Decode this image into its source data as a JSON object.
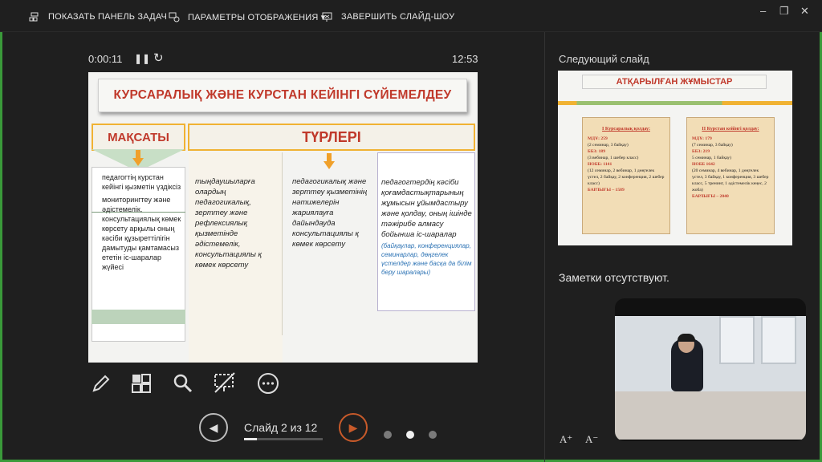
{
  "toolbar": {
    "show_taskbar": "ПОКАЗАТЬ ПАНЕЛЬ ЗАДАЧ",
    "display_settings": "ПАРАМЕТРЫ ОТОБРАЖЕНИЯ ▾",
    "end_show": "ЗАВЕРШИТЬ СЛАЙД-ШОУ"
  },
  "window": {
    "minimize": "–",
    "restore": "❐",
    "close": "✕"
  },
  "timer": {
    "elapsed": "0:00:11",
    "clock": "12:53"
  },
  "current_slide": {
    "title": "КУРСАРАЛЫҚ ЖӘНЕ КУРСТАН КЕЙІНГІ СҮЙЕМЕЛДЕУ",
    "goal_header": "МАҚСАТЫ",
    "types_header": "ТҮРЛЕРІ",
    "goal_lead": "педагогтің курстан кейінгі қызметін үздіксіз",
    "goal_text": "мониторингтеу және әдістемелік, консультациялық көмек көрсету арқылы оның кәсіби құзыреттілігін дамытуды қамтамасыз ететін іс-шаралар жүйесі",
    "type1": "тыңдаушыларға олардың педагогикалық, зерттеу және рефлексиялық қызметінде әдістемелік, консультациялы қ көмек көрсету",
    "type2": "педагогикалық және зерттеу қызметінің нәтижелерін жариялауға дайындауда консультациялы қ көмек көрсету",
    "type3": "педагогтердің кәсіби қоғамдастықтарының жұмысын ұйымдастыру және қолдау, оның ішінде тәжірибе алмасу бойынша іс-шаралар",
    "type3_note": "(байқаулар, конференциялар, семинарлар, дөңгелек үстелдер және басқа да білім беру шаралары)"
  },
  "tools": {
    "pen": "pen-icon",
    "grid": "see-all-slides-icon",
    "zoom": "zoom-icon",
    "pointer": "screen-pointer-icon",
    "more": "more-options-icon"
  },
  "navigation": {
    "slide_counter": "Слайд 2 из 12",
    "progress": 0.1667,
    "dots": [
      false,
      true,
      false
    ]
  },
  "next_panel": {
    "label": "Следующий слайд",
    "title": "АТҚАРЫЛҒАН ЖҰМЫСТАР",
    "left_scroll": {
      "heading": "І Курсаралық қолдау:",
      "l1": "МДҰ: 259",
      "l1b": "(2 семинар, 3 байқау)",
      "l2": "ББЗ: 189",
      "l2b": "(3 вебинар, 1 шебер класс)",
      "l3": "НОББ: 1141",
      "l3b": "(12 семинар, 2 вебинар, 1 дөңгелек үстел, 2 байқау, 2 конференция, 2 шебер класс)",
      "total": "БАРЛЫҒЫ – 1589"
    },
    "right_scroll": {
      "heading": "ІІ Курстан кейінгі қолдау:",
      "l1": "МДҰ: 179",
      "l1b": "(7 семинар, 3 байқау)",
      "l2": "ББЗ: 219",
      "l2b": "5 семинар, 1 байқау)",
      "l3": "НОББ 1642",
      "l3b": "(20 семинар, 4 вебинар, 1 дөңгелек үстел, 3 байқау, 1 конференция, 3 шебер класс, 5 тренинг, 1 әдістемелік кеңес, 2 жоба)",
      "total": "БАРЛЫҒЫ – 2040"
    }
  },
  "notes": {
    "text": "Заметки отсутствуют."
  },
  "font_controls": {
    "increase": "A⁺",
    "decrease": "A⁻"
  }
}
